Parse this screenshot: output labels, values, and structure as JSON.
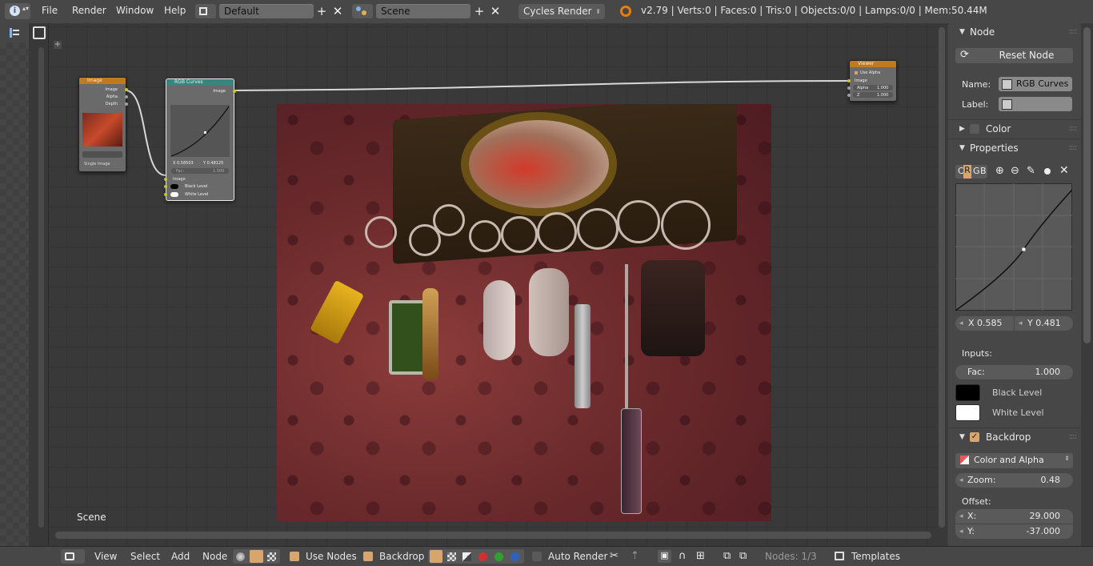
{
  "topbar": {
    "menus": [
      "File",
      "Render",
      "Window",
      "Help"
    ],
    "layout": "Default",
    "scene": "Scene",
    "engine": "Cycles Render",
    "stats": "v2.79 | Verts:0 | Faces:0 | Tris:0 | Objects:0/0 | Lamps:0/0 | Mem:50.44M"
  },
  "editor": {
    "scene_label": "Scene",
    "nodes": {
      "image": {
        "title": "Image",
        "outputs": [
          "Image",
          "Alpha",
          "Depth"
        ],
        "mode": "Single Image"
      },
      "rgb_curves": {
        "title": "RGB Curves",
        "output": "Image",
        "x": "X 0.58503",
        "y": "Y 0.48125",
        "fac_label": "Fac:",
        "fac_value": "1.000",
        "inputs": [
          "Image",
          "Black Level",
          "White Level"
        ]
      },
      "viewer": {
        "title": "Viewer",
        "use_alpha": "Use Alpha",
        "input": "Image",
        "alpha_label": "Alpha",
        "alpha_value": "1.000",
        "z_label": "Z",
        "z_value": "1.000"
      }
    }
  },
  "panel": {
    "node_header": "Node",
    "reset_node": "Reset Node",
    "name_label": "Name:",
    "name_value": "RGB Curves",
    "label_label": "Label:",
    "label_value": "",
    "color_header": "Color",
    "properties_header": "Properties",
    "channels": [
      "C",
      "R",
      "G",
      "B"
    ],
    "active_channel": "R",
    "curve_x": "X 0.585",
    "curve_y": "Y 0.481",
    "curve_point": [
      0.585,
      0.481
    ],
    "inputs_label": "Inputs:",
    "fac_label": "Fac:",
    "fac_value": "1.000",
    "black_level": "Black Level",
    "white_level": "White Level",
    "backdrop_header": "Backdrop",
    "backdrop_mode": "Color and Alpha",
    "zoom_label": "Zoom:",
    "zoom_value": "0.48",
    "offset_label": "Offset:",
    "offset_x_label": "X:",
    "offset_x": "29.000",
    "offset_y_label": "Y:",
    "offset_y": "-37.000"
  },
  "bottombar": {
    "menus": [
      "View",
      "Select",
      "Add",
      "Node"
    ],
    "use_nodes": "Use Nodes",
    "backdrop": "Backdrop",
    "auto_render": "Auto Render",
    "nodes_count": "Nodes: 1/3",
    "templates": "Templates"
  },
  "colors": {
    "accent": "#d8a66d",
    "node_header_image": "#c07a1f",
    "node_header_curves": "#39847c",
    "socket_yellow": "#c7c729",
    "socket_grey": "#a1a1a1"
  }
}
